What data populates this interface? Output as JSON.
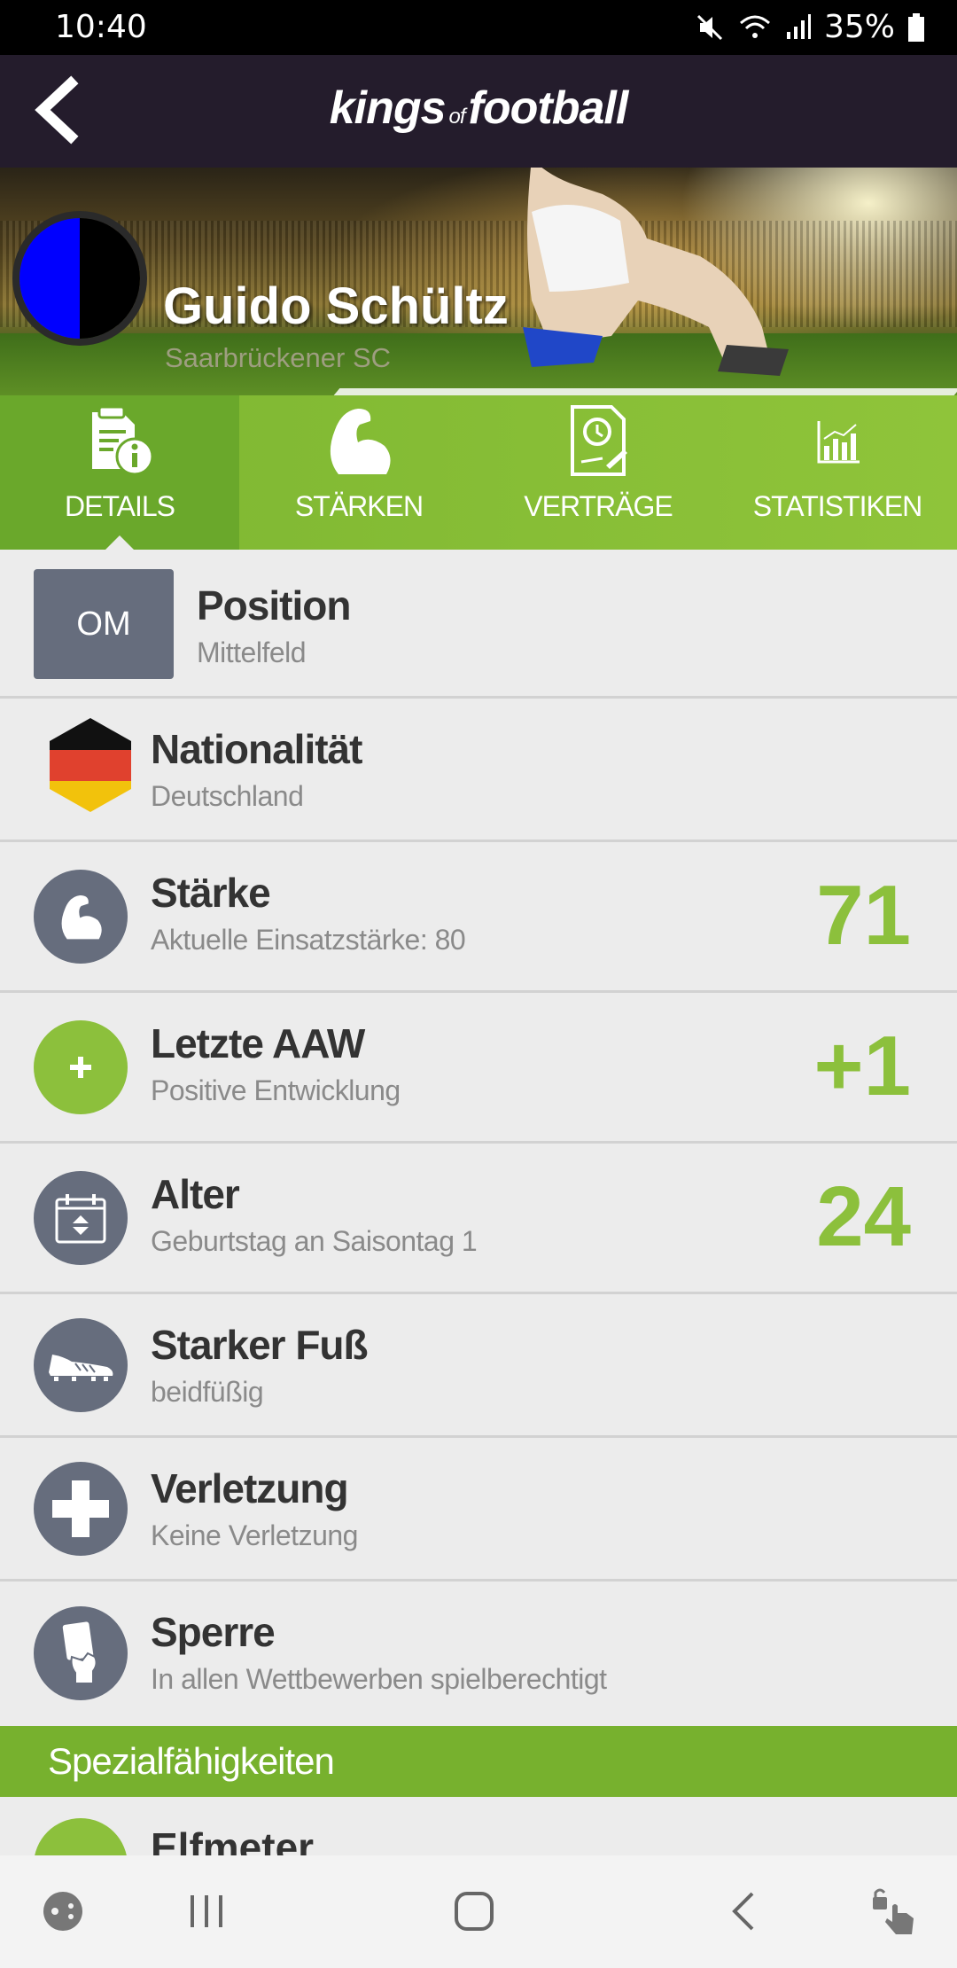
{
  "status_bar": {
    "time": "10:40",
    "battery": "35%"
  },
  "app_bar": {
    "logo_word1": "kings",
    "logo_of": "of",
    "logo_word2": "football"
  },
  "player": {
    "name": "Guido Schültz",
    "club": "Saarbrückener SC"
  },
  "club_colors": [
    "#0000ff",
    "#000000"
  ],
  "tabs": [
    {
      "label": "DETAILS",
      "active": true
    },
    {
      "label": "STÄRKEN",
      "active": false
    },
    {
      "label": "VERTRÄGE",
      "active": false
    },
    {
      "label": "STATISTIKEN",
      "active": false
    }
  ],
  "details": {
    "position": {
      "badge": "OM",
      "title": "Position",
      "sub": "Mittelfeld"
    },
    "nationality": {
      "title": "Nationalität",
      "sub": "Deutschland"
    },
    "strength": {
      "title": "Stärke",
      "sub": "Aktuelle Einsatzstärke: 80",
      "value": "71"
    },
    "last_aaw": {
      "title": "Letzte AAW",
      "sub": "Positive Entwicklung",
      "value": "+1"
    },
    "age": {
      "title": "Alter",
      "sub": "Geburtstag an Saisontag 1",
      "value": "24"
    },
    "foot": {
      "title": "Starker Fuß",
      "sub": "beidfüßig"
    },
    "injury": {
      "title": "Verletzung",
      "sub": "Keine Verletzung"
    },
    "suspension": {
      "title": "Sperre",
      "sub": "In allen Wettbewerben spielberechtigt"
    }
  },
  "special_section": {
    "title": "Spezialfähigkeiten"
  },
  "special_items": [
    {
      "title": "Elfmeter"
    }
  ],
  "accent_colors": {
    "green": "#8cc03c",
    "icon_grey": "#666d7d",
    "appbar": "#241c2c"
  }
}
